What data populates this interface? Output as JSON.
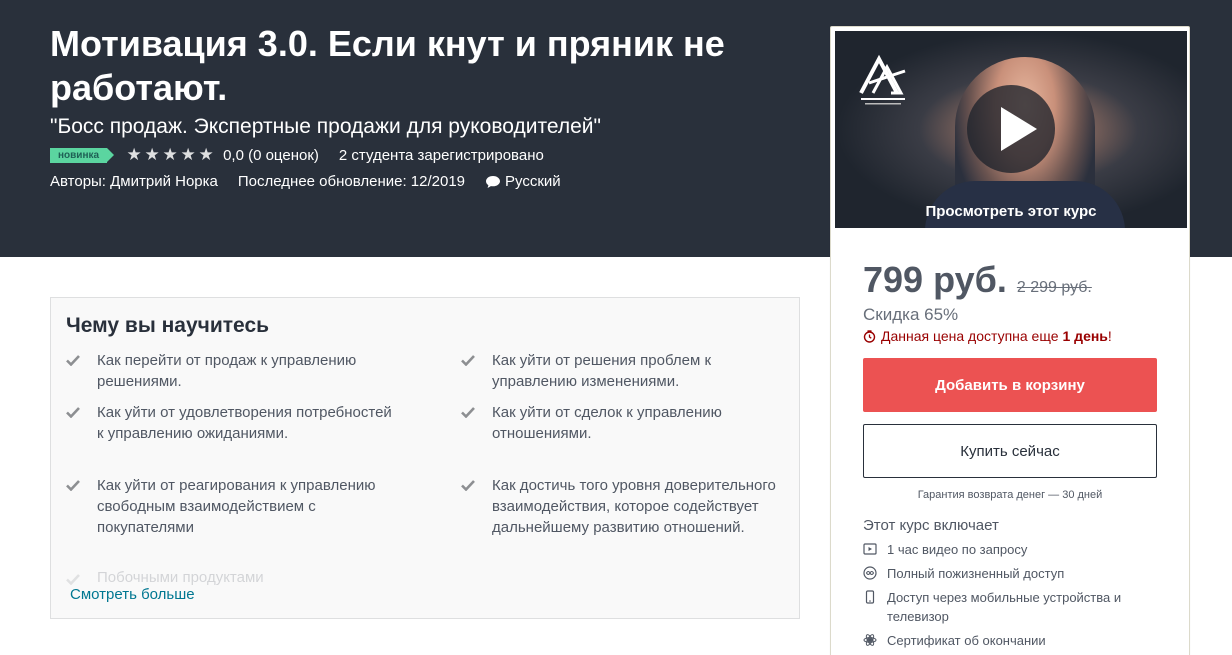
{
  "course": {
    "title": "Мотивация 3.0. Если кнут и пряник не работают.",
    "subtitle": "\"Босс продаж. Экспертные продажи для руководителей\"",
    "badge": "новинка",
    "rating_value": 0.0,
    "rating_text": "0,0 (0 оценок)",
    "students": "2 студента зарегистрировано",
    "authors": "Авторы: Дмитрий Норка",
    "updated": "Последнее обновление: 12/2019",
    "language": "Русский"
  },
  "sidebar": {
    "preview_label": "Просмотреть этот курс",
    "price": "799 руб.",
    "old_price": "2 299 руб.",
    "discount": "Скидка 65%",
    "deadline_text": "Данная цена доступна еще",
    "deadline_bold": "1 день",
    "deadline_end": "!",
    "add_to_cart": "Добавить в корзину",
    "buy_now": "Купить сейчас",
    "guarantee": "Гарантия возврата денег — 30 дней",
    "includes_title": "Этот курс включает",
    "includes": [
      {
        "icon": "video-icon",
        "text": "1 час видео по запросу"
      },
      {
        "icon": "infinity-icon",
        "text": "Полный пожизненный доступ"
      },
      {
        "icon": "mobile-icon",
        "text": "Доступ через мобильные устройства и телевизор"
      },
      {
        "icon": "certificate-icon",
        "text": "Сертификат об окончании"
      }
    ]
  },
  "learn": {
    "title": "Чему вы научитесь",
    "left": [
      "Как перейти от продаж к управлению решениями.",
      "Как уйти от удовлетворения потребностей к управлению ожиданиями.",
      "Как уйти от реагирования к управлению свободным взаимодействием с покупателями"
    ],
    "right": [
      "Как уйти от решения проблем к управлению изменениями.",
      "Как уйти от сделок к управлению отношениями.",
      "Как достичь того уровня доверительного взаимодействия, которое содействует дальнейшему развитию отношений."
    ],
    "faded": "Побочными продуктами",
    "see_more": "Смотреть больше"
  },
  "colors": {
    "hero_bg": "#29303b",
    "cart_button": "#ec5252",
    "badge": "#5bd5a0",
    "link": "#007791",
    "deadline": "#990000"
  }
}
